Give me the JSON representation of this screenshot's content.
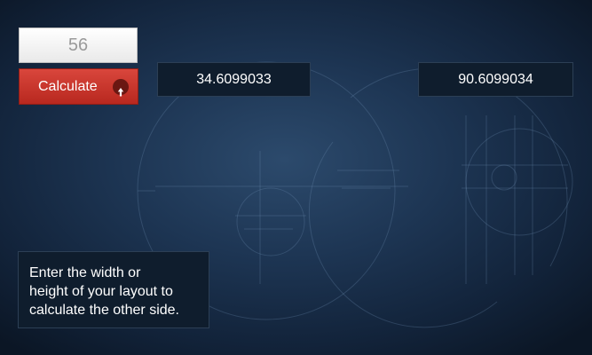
{
  "input": {
    "value": "56"
  },
  "calculate_button": {
    "label": "Calculate",
    "icon": "arrow-up-circle-icon"
  },
  "results": {
    "first": "34.6099033",
    "second": "90.6099034"
  },
  "info_text": "Enter the width or\nheight of your layout to\ncalculate the other side.",
  "colors": {
    "background": "#1d3553",
    "button": "#c7332a",
    "result_box": "#0f1d2d"
  }
}
